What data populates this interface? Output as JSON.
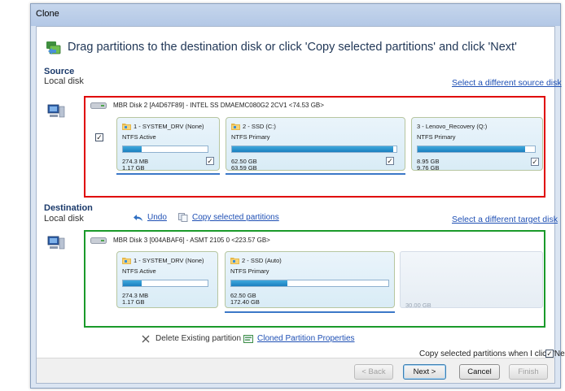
{
  "window": {
    "title": "Clone"
  },
  "header": {
    "instruction": "Drag partitions to the destination disk or click 'Copy selected partitions' and click 'Next'"
  },
  "source": {
    "title": "Source",
    "subtitle": "Local disk",
    "select_link": "Select a different source disk",
    "disk_label": "MBR Disk 2 [A4D67F89] - INTEL SS DMAEMC080G2   2CV1  <74.53 GB>",
    "partitions": [
      {
        "name": "1 - SYSTEM_DRV (None)",
        "type": "NTFS Active",
        "used": "274.3 MB",
        "total": "1.17 GB",
        "fill": 0.22,
        "checked": true
      },
      {
        "name": "2 - SSD (C:)",
        "type": "NTFS Primary",
        "used": "62.50 GB",
        "total": "63.59 GB",
        "fill": 0.98,
        "checked": true
      },
      {
        "name": "3 - Lenovo_Recovery (Q:)",
        "type": "NTFS Primary",
        "used": "8.95 GB",
        "total": "9.76 GB",
        "fill": 0.92,
        "checked": true
      }
    ]
  },
  "destination": {
    "title": "Destination",
    "subtitle": "Local disk",
    "undo": "Undo",
    "copy_selected": "Copy selected partitions",
    "select_link": "Select a different target disk",
    "disk_label": "MBR Disk 3 [004ABAF6] - ASMT    2105        0  <223.57 GB>",
    "partitions": [
      {
        "name": "1 - SYSTEM_DRV (None)",
        "type": "NTFS Active",
        "used": "274.3 MB",
        "total": "1.17 GB",
        "fill": 0.22
      },
      {
        "name": "2 - SSD (Auto)",
        "type": "NTFS Primary",
        "used": "62.50 GB",
        "total": "172.40 GB",
        "fill": 0.36
      }
    ],
    "unallocated": "30.00 GB"
  },
  "actions": {
    "delete_existing": "Delete Existing partition",
    "cloned_properties": "Cloned Partition Properties"
  },
  "footer": {
    "copy_on_next": "Copy selected partitions when I click 'Next'",
    "copy_on_next_checked": true
  },
  "buttons": {
    "back": "< Back",
    "next": "Next >",
    "cancel": "Cancel",
    "finish": "Finish"
  }
}
